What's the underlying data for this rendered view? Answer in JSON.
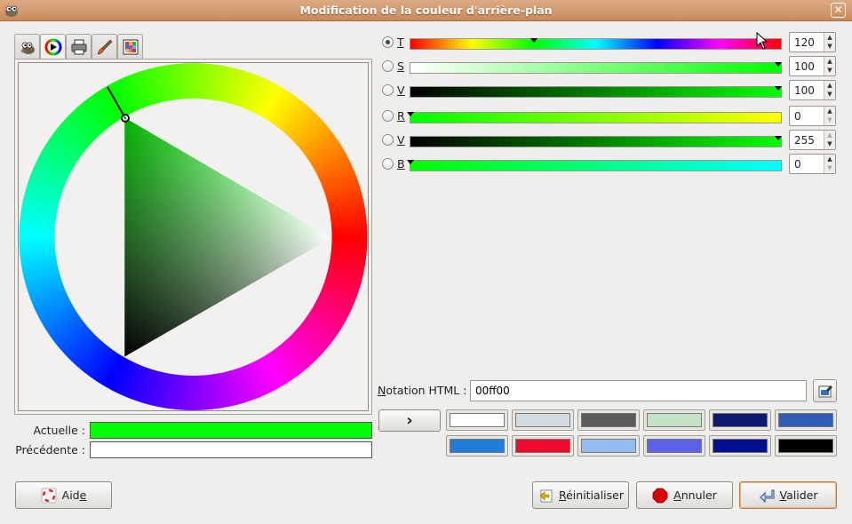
{
  "window": {
    "title": "Modification de la couleur d'arrière-plan",
    "close_glyph": "✕"
  },
  "tabs": [
    {
      "name": "gimp-wilber-icon"
    },
    {
      "name": "color-wheel-icon"
    },
    {
      "name": "printer-icon"
    },
    {
      "name": "brush-icon"
    },
    {
      "name": "palette-icon"
    }
  ],
  "current": {
    "label": "Actuelle :",
    "color": "#00ff00"
  },
  "previous": {
    "label": "Précédente :",
    "color": "#ffffff"
  },
  "channels": [
    {
      "label": "T",
      "value": "120",
      "selected": true
    },
    {
      "label": "S",
      "value": "100",
      "selected": false
    },
    {
      "label": "V",
      "value": "100",
      "selected": false
    },
    {
      "label": "R",
      "value": "0",
      "selected": false
    },
    {
      "label": "V",
      "value": "255",
      "selected": false
    },
    {
      "label": "B",
      "value": "0",
      "selected": false
    }
  ],
  "html_notation": {
    "label": "Notation HTML :",
    "value": "00ff00"
  },
  "history": {
    "arrow_glyph": "›",
    "colors": [
      "#ffffff",
      "#d3dce0",
      "#5c5c5c",
      "#c3e2c5",
      "#0b1a6e",
      "#2e5cb6",
      "#1f7fd8",
      "#f00b2e",
      "#93bcf1",
      "#5c63ea",
      "#000f8f",
      "#000000"
    ]
  },
  "buttons": {
    "help": "Aide",
    "reset": "Réinitialiser",
    "cancel": "Annuler",
    "ok": "Valider"
  }
}
